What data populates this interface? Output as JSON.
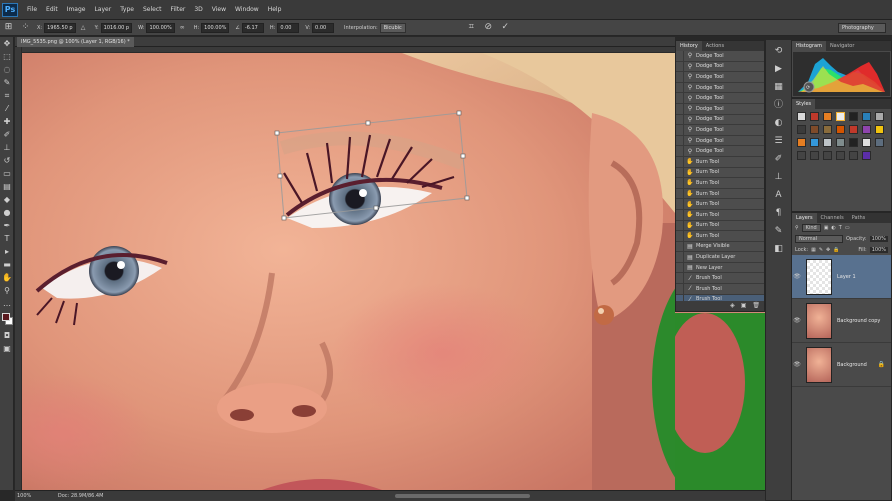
{
  "app": {
    "logo": "Ps"
  },
  "menu": [
    "File",
    "Edit",
    "Image",
    "Layer",
    "Type",
    "Select",
    "Filter",
    "3D",
    "View",
    "Window",
    "Help"
  ],
  "options": {
    "x_label": "X:",
    "x_value": "1965.50 p",
    "y_label": "Y:",
    "y_value": "1016.00 p",
    "w_label": "W:",
    "w_value": "100.00%",
    "h_label": "H:",
    "h_value": "100.00%",
    "angle_value": "-6.17",
    "hskew_label": "H:",
    "hskew_value": "0.00",
    "vskew_label": "V:",
    "vskew_value": "0.00",
    "interp_label": "Interpolation:",
    "interp_value": "Bicubic",
    "workspace": "Photography"
  },
  "document": {
    "tab": "IMG_5535.png @ 100% (Layer 1, RGB/16) *"
  },
  "status": {
    "zoom": "100%",
    "doc": "Doc: 28.9M/86.4M"
  },
  "history": {
    "tabs": [
      "History",
      "Actions"
    ],
    "items": [
      {
        "icon": "dodge",
        "label": "Dodge Tool"
      },
      {
        "icon": "dodge",
        "label": "Dodge Tool"
      },
      {
        "icon": "dodge",
        "label": "Dodge Tool"
      },
      {
        "icon": "dodge",
        "label": "Dodge Tool"
      },
      {
        "icon": "dodge",
        "label": "Dodge Tool"
      },
      {
        "icon": "dodge",
        "label": "Dodge Tool"
      },
      {
        "icon": "dodge",
        "label": "Dodge Tool"
      },
      {
        "icon": "dodge",
        "label": "Dodge Tool"
      },
      {
        "icon": "dodge",
        "label": "Dodge Tool"
      },
      {
        "icon": "dodge",
        "label": "Dodge Tool"
      },
      {
        "icon": "burn",
        "label": "Burn Tool"
      },
      {
        "icon": "burn",
        "label": "Burn Tool"
      },
      {
        "icon": "burn",
        "label": "Burn Tool"
      },
      {
        "icon": "burn",
        "label": "Burn Tool"
      },
      {
        "icon": "burn",
        "label": "Burn Tool"
      },
      {
        "icon": "burn",
        "label": "Burn Tool"
      },
      {
        "icon": "burn",
        "label": "Burn Tool"
      },
      {
        "icon": "burn",
        "label": "Burn Tool"
      },
      {
        "icon": "layer",
        "label": "Merge Visible"
      },
      {
        "icon": "layer",
        "label": "Duplicate Layer"
      },
      {
        "icon": "layer",
        "label": "New Layer"
      },
      {
        "icon": "brush",
        "label": "Brush Tool"
      },
      {
        "icon": "brush",
        "label": "Brush Tool"
      },
      {
        "icon": "brush",
        "label": "Brush Tool"
      }
    ]
  },
  "right": {
    "histogram_tabs": [
      "Histogram",
      "Navigator"
    ],
    "styles_tab": "Styles",
    "layers_tabs": [
      "Layers",
      "Channels",
      "Paths"
    ],
    "blend_mode": "Normal",
    "opacity_label": "Opacity:",
    "opacity_value": "100%",
    "lock_label": "Lock:",
    "fill_label": "Fill:",
    "fill_value": "100%",
    "kind_label": "Kind",
    "layers": [
      {
        "name": "Layer 1",
        "selected": true
      },
      {
        "name": "Background copy",
        "selected": false
      },
      {
        "name": "Background",
        "selected": false
      }
    ]
  },
  "colors": {
    "accent": "#58718f",
    "history_selected": "#4a5f78"
  }
}
